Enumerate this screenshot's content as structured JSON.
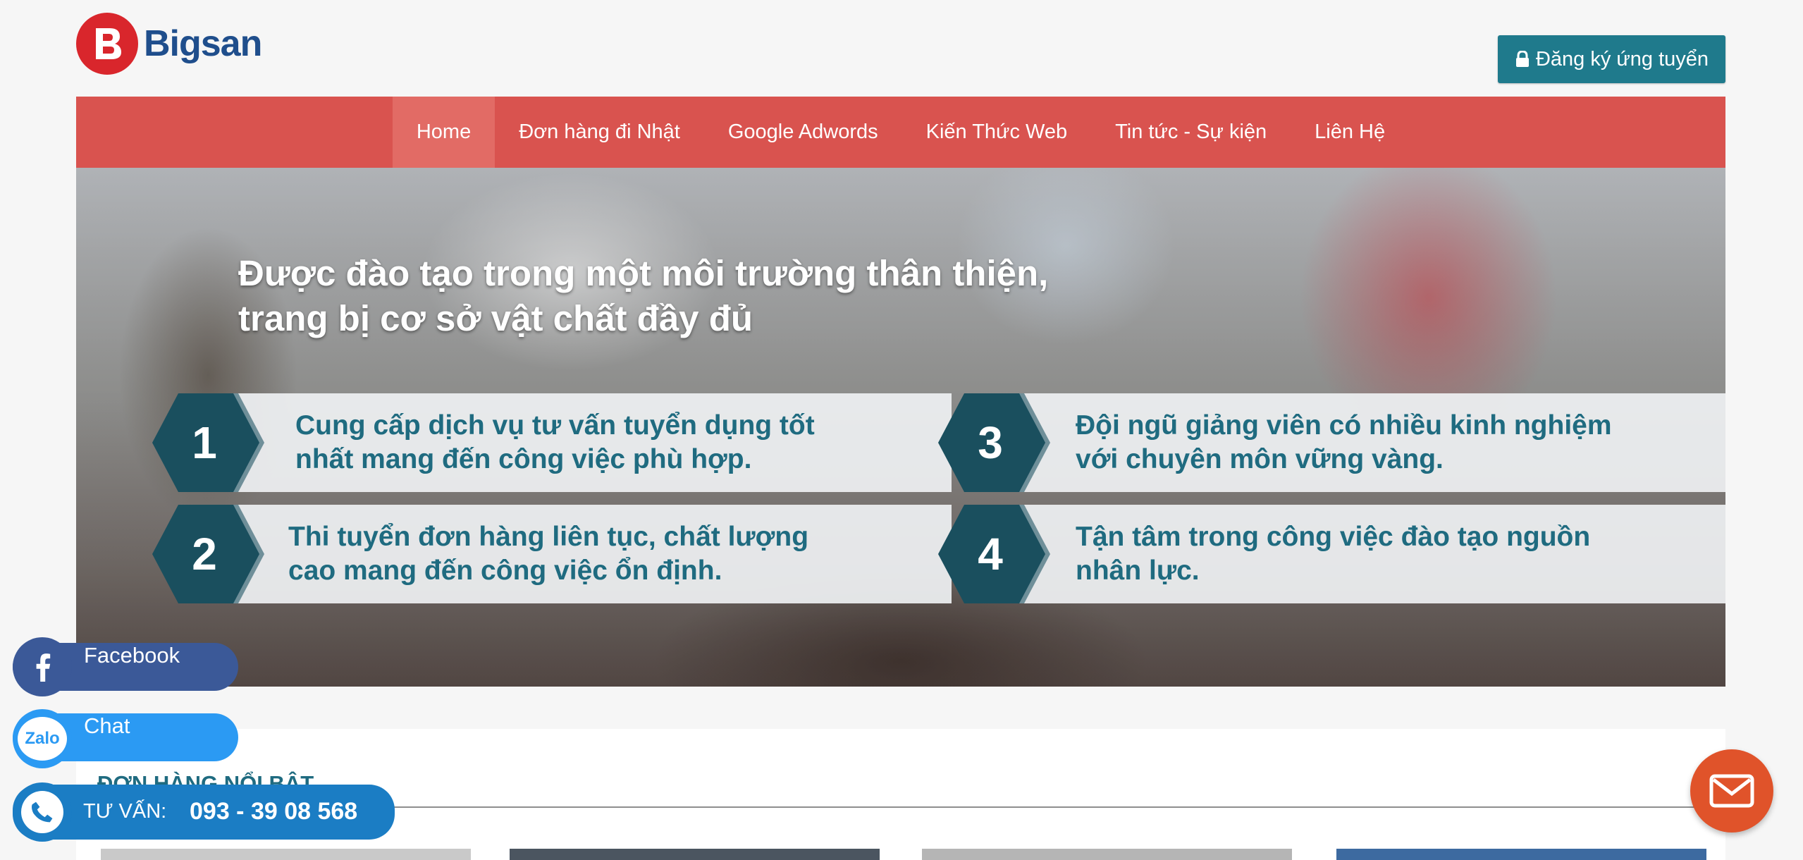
{
  "header": {
    "logo_text": "Bigsan",
    "register_button": "Đăng ký ứng tuyển"
  },
  "nav": {
    "items": [
      {
        "label": "Home",
        "active": true
      },
      {
        "label": "Đơn hàng đi Nhật",
        "active": false
      },
      {
        "label": "Google Adwords",
        "active": false
      },
      {
        "label": "Kiến Thức Web",
        "active": false
      },
      {
        "label": "Tin tức - Sự kiện",
        "active": false
      },
      {
        "label": "Liên Hệ",
        "active": false
      }
    ]
  },
  "hero": {
    "title_line1": "Được đào tạo trong một môi trường thân thiện,",
    "title_line2": "trang bị cơ sở vật chất đầy đủ",
    "features": [
      {
        "number": "1",
        "line1": "Cung cấp dịch vụ tư vấn tuyển dụng tốt",
        "line2": "nhất mang đến công việc phù hợp."
      },
      {
        "number": "2",
        "line1": "Thi tuyển đơn hàng liên tục, chất lượng",
        "line2": "cao mang đến công việc ổn định."
      },
      {
        "number": "3",
        "line1": "Đội ngũ giảng viên có nhiều kinh nghiệm",
        "line2": "với chuyên môn vững vàng."
      },
      {
        "number": "4",
        "line1": "Tận tâm trong công việc đào tạo nguồn",
        "line2": "nhân lực."
      }
    ]
  },
  "featured": {
    "title": "ĐƠN HÀNG NỔI BẬT"
  },
  "floating": {
    "facebook_label": "Facebook",
    "zalo_label": "Chat",
    "zalo_icon_text": "Zalo",
    "phone_prefix": "TƯ VẤN:",
    "phone_number": "093 - 39 08 568"
  },
  "colors": {
    "brand_red": "#d9534f",
    "accent_teal": "#1f7a8c",
    "hex_dark": "#1a4f5e",
    "facebook": "#3b5998",
    "zalo": "#2b9af3",
    "mail": "#e0532a"
  }
}
